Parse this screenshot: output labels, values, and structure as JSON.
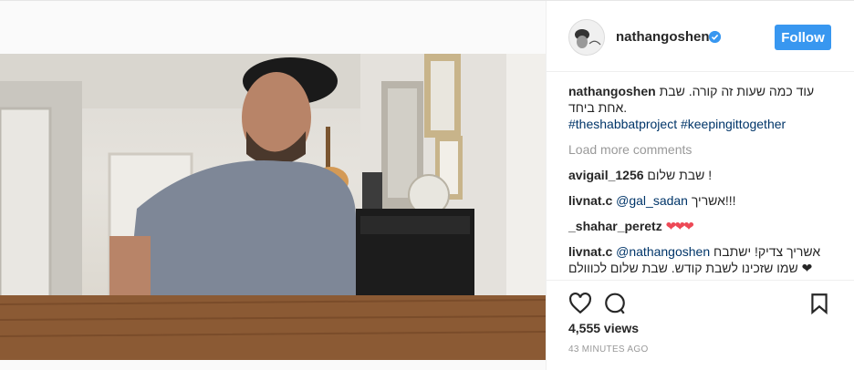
{
  "post": {
    "username": "nathangoshen",
    "follow_label": "Follow",
    "caption_user": "nathangoshen",
    "caption_text": "עוד כמה שעות זה קורה. שבת אחת ביחד.",
    "hashtag1": "#theshabbatproject",
    "hashtag2": "#keepingittogether",
    "load_more": "Load more comments",
    "comments": [
      {
        "user": "avigail_1256",
        "text": "שבת שלום !"
      },
      {
        "user": "livnat.c",
        "mention": "@gal_sadan",
        "text": "אשריך!!!"
      },
      {
        "user": "_shahar_peretz",
        "text": "❤❤❤"
      },
      {
        "user": "livnat.c",
        "mention": "@nathangoshen",
        "text": "אשריך צדיק! ישתבח שמו שזכינו לשבת קודש. שבת שלום לכווולם ❤"
      }
    ],
    "views": "4,555 views",
    "time": "43 MINUTES AGO"
  },
  "colors": {
    "accent": "#3897f0",
    "link": "#003569",
    "muted": "#999999"
  },
  "icons": [
    "heart-icon",
    "comment-icon",
    "bookmark-icon",
    "verified-icon"
  ]
}
